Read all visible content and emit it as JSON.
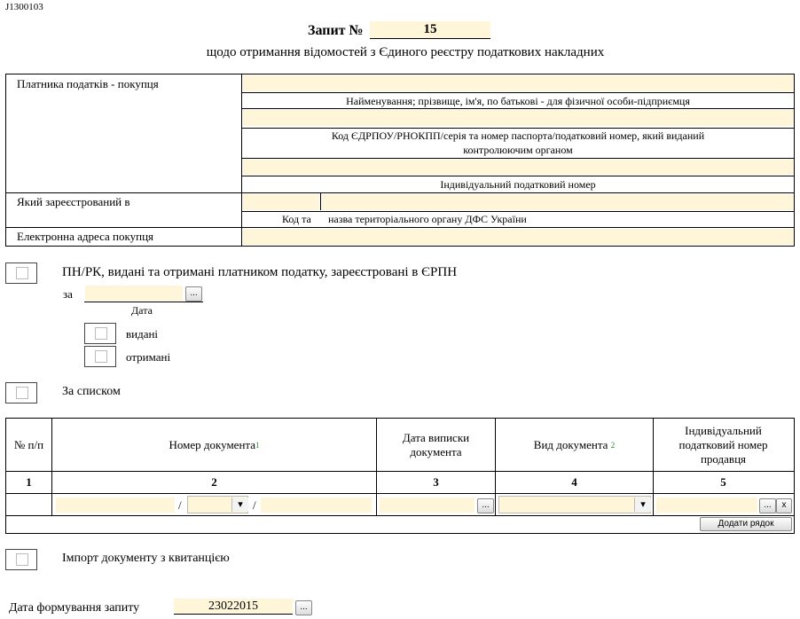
{
  "form_code": "J1300103",
  "title": {
    "label": "Запит №",
    "number": "15"
  },
  "subtitle": "щодо отримання відомостей з Єдиного реєстру податкових накладних",
  "buyer": {
    "label": "Платника податків - покупця",
    "name_caption": "Найменування; прізвище, ім'я, по батькові - для фізичної особи-підприємця",
    "code_caption_line1": "Код ЄДРПОУ/РНОКПП/серія та номер паспорта/податковий номер, який виданий",
    "code_caption_line2": "контролюючим органом",
    "ipn_caption": "Індивідуальний податковий номер",
    "registered_label": "Який зареєстрований в",
    "code_caption": "Код та",
    "authority_caption": "назва територіального органу ДФС України",
    "email_label": "Електронна адреса покупця"
  },
  "option_period": {
    "label": "ПН/РК, видані та отримані платником податку, зареєстровані в ЄРПН",
    "za_label": "за",
    "date_caption": "Дата",
    "date_button": "...",
    "issued_label": "видані",
    "received_label": "отримані"
  },
  "option_list": {
    "label": "За списком"
  },
  "table": {
    "headers": {
      "num": "№ п/п",
      "doc_number": "Номер документа",
      "doc_number_note": "1",
      "doc_date": "Дата виписки документа",
      "doc_type": "Вид документа",
      "doc_type_note": "2",
      "seller_ipn": "Індивідуальний податковий номер продавця"
    },
    "col_numbers": [
      "1",
      "2",
      "3",
      "4",
      "5"
    ],
    "slash": "/",
    "date_button": "...",
    "ipn_button": "...",
    "clear_button": "x",
    "add_row_button": "Додати рядок"
  },
  "option_import": {
    "label": "Імпорт документу з квитанцією"
  },
  "request_date": {
    "label": "Дата формування запиту",
    "value": "23022015",
    "button": "..."
  },
  "colors": {
    "field_fill": "#fff5d9",
    "note_color": "#2a8a2a"
  },
  "icons": [
    "chevron-down-icon"
  ]
}
